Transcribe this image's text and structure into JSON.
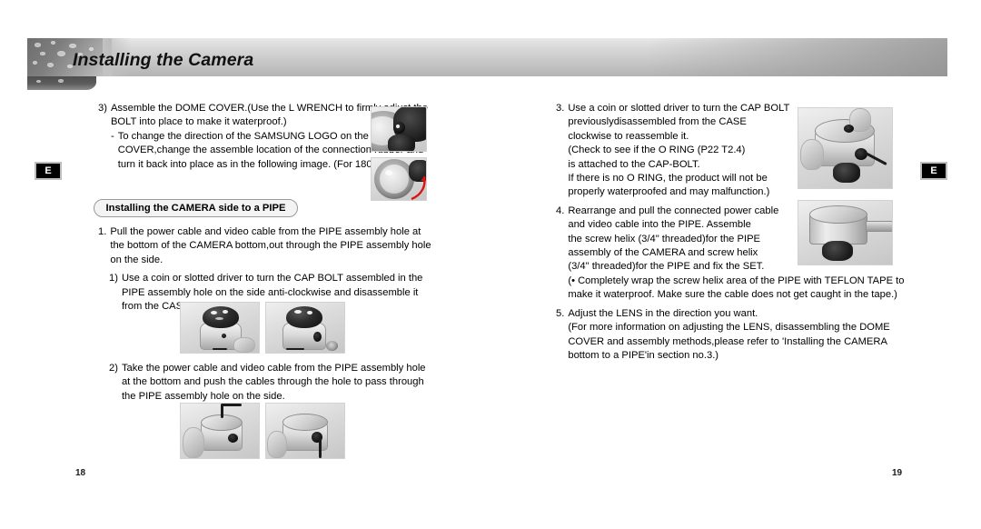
{
  "header": {
    "title": "Installing the Camera"
  },
  "markers": {
    "left_label": "E",
    "right_label": "E"
  },
  "left_column": {
    "item3": {
      "marker": "3)",
      "text": "Assemble the DOME COVER.(Use the L WRENCH to firmly adjust the BOLT into place to make it waterproof.)"
    },
    "item3_dash": {
      "marker": "-",
      "text": "To change the direction of the SAMSUNG LOGO on the DOME COVER,change the assemble location of the connection rubber and turn it back into place as in the following image. (For 180 • only)"
    },
    "pill_heading": "Installing the CAMERA side to a PIPE",
    "item1": {
      "marker": "1.",
      "text": "Pull the power cable and video cable from the PIPE assembly hole at the bottom of the CAMERA bottom,out through the PIPE assembly hole on the side."
    },
    "item1_sub1": {
      "marker": "1)",
      "text": "Use a coin or slotted driver to turn the CAP BOLT assembled in the PIPE assembly hole on the side anti-clockwise and disassemble it from the CASE."
    },
    "item1_sub2": {
      "marker": "2)",
      "text": "Take the power cable and video cable from the PIPE assembly hole at the bottom and push the cables through the hole to pass through the PIPE assembly hole on the side."
    }
  },
  "right_column": {
    "item3": {
      "marker": "3.",
      "line1": "Use a coin or slotted driver to turn the CAP BOLT",
      "line2": "previouslydisassembled from the CASE",
      "line3": "clockwise to reassemble it.",
      "line4": "(Check to see if the O RING (P22 T2.4)",
      "line5": "is attached to the CAP-BOLT.",
      "line6": "If there is no O RING, the product will not be",
      "line7": "properly waterproofed and may malfunction.)"
    },
    "item4": {
      "marker": "4.",
      "line1": "Rearrange and pull the connected power cable",
      "line2": "and video cable into the PIPE. Assemble",
      "line3": "the screw helix (3/4\" threaded)for the PIPE",
      "line4": "assembly of the CAMERA and screw helix",
      "line5": "(3/4\" threaded)for the PIPE and fix the SET.",
      "note": "(• Completely wrap the screw helix area of the PIPE with TEFLON TAPE to make it waterproof. Make sure the cable does not get caught in the tape.)"
    },
    "item5": {
      "marker": "5.",
      "line1": "Adjust the LENS in the direction you want.",
      "note": "(For more information on adjusting the LENS, disassembling the DOME COVER and assembly methods,please refer to 'Installing the CAMERA bottom to a PIPE'in section no.3.)"
    }
  },
  "photos": {
    "left_top_1": "dome-cover-bolt-closeup-photo",
    "left_top_2": "dome-cover-connection-rubber-photo",
    "left_mid_1": "camera-side-capbolt-driver-photo",
    "left_mid_2": "camera-side-capbolt-removed-photo",
    "left_bot_1": "camera-cable-routing-photo",
    "left_bot_2": "camera-cable-through-side-hole-photo",
    "right_top": "hand-turning-capbolt-photo",
    "right_bot": "camera-assembled-to-pipe-photo"
  },
  "footer": {
    "page_left": "18",
    "page_right": "19"
  }
}
